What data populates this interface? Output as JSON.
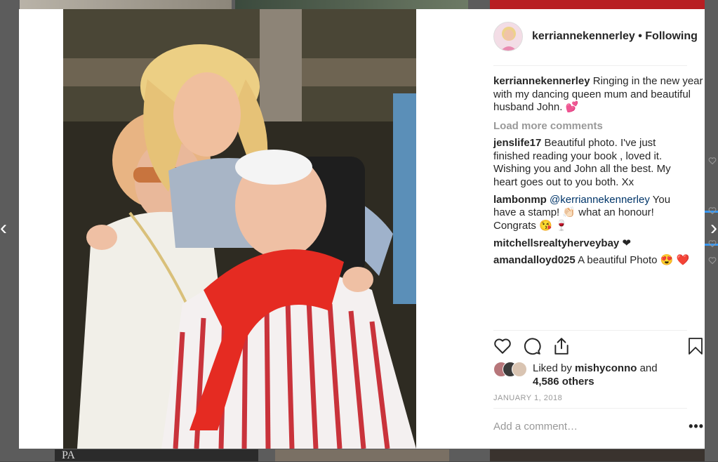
{
  "post": {
    "author": "kerriannekennerley",
    "separator": "•",
    "follow_status": "Following",
    "caption": "Ringing in the new year with my dancing queen mum and beautiful husband John. 💕",
    "load_more": "Load more comments",
    "comments": [
      {
        "user": "jenslife17",
        "text": "Beautiful photo. I've just finished reading your book , loved it. Wishing you and John all the best. My heart goes out to you both. Xx"
      },
      {
        "user": "lambonmp",
        "mention": "@kerriannekennerley",
        "text": "You have a stamp! 👏🏻  what an honour! Congrats 😘 🍷"
      },
      {
        "user": "mitchellsrealtyherveybay",
        "text": "❤"
      },
      {
        "user": "amandalloyd025",
        "text": "A beautiful Photo 😍 ❤️"
      }
    ],
    "liked_by_prefix": "Liked by",
    "liked_by_user": "mishyconno",
    "liked_by_and": "and",
    "liked_by_others": "4,586 others",
    "date": "JANUARY 1, 2018",
    "comment_placeholder": "Add a comment…",
    "more_options": "•••"
  },
  "background": {
    "bottom_tile_text": "PA"
  },
  "icons": {
    "like": "heart-icon",
    "comment": "comment-bubble-icon",
    "share": "share-icon",
    "save": "bookmark-icon",
    "nav_left": "chevron-left-icon",
    "nav_right": "chevron-right-icon"
  },
  "nav": {
    "left": "‹",
    "right": "›"
  },
  "colors": {
    "text": "#262626",
    "muted": "#999999",
    "mention": "#003569",
    "accent_blue": "#3897f0"
  }
}
